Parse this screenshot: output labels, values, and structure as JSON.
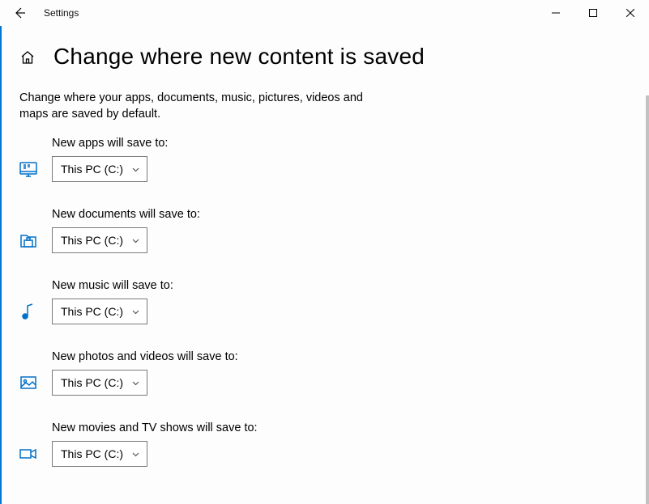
{
  "window": {
    "title": "Settings"
  },
  "page": {
    "heading": "Change where new content is saved",
    "description": "Change where your apps, documents, music, pictures, videos and maps are saved by default."
  },
  "settings": [
    {
      "label": "New apps will save to:",
      "value": "This PC (C:)",
      "icon": "apps"
    },
    {
      "label": "New documents will save to:",
      "value": "This PC (C:)",
      "icon": "documents"
    },
    {
      "label": "New music will save to:",
      "value": "This PC (C:)",
      "icon": "music"
    },
    {
      "label": "New photos and videos will save to:",
      "value": "This PC (C:)",
      "icon": "photos"
    },
    {
      "label": "New movies and TV shows will save to:",
      "value": "This PC (C:)",
      "icon": "movies"
    }
  ]
}
